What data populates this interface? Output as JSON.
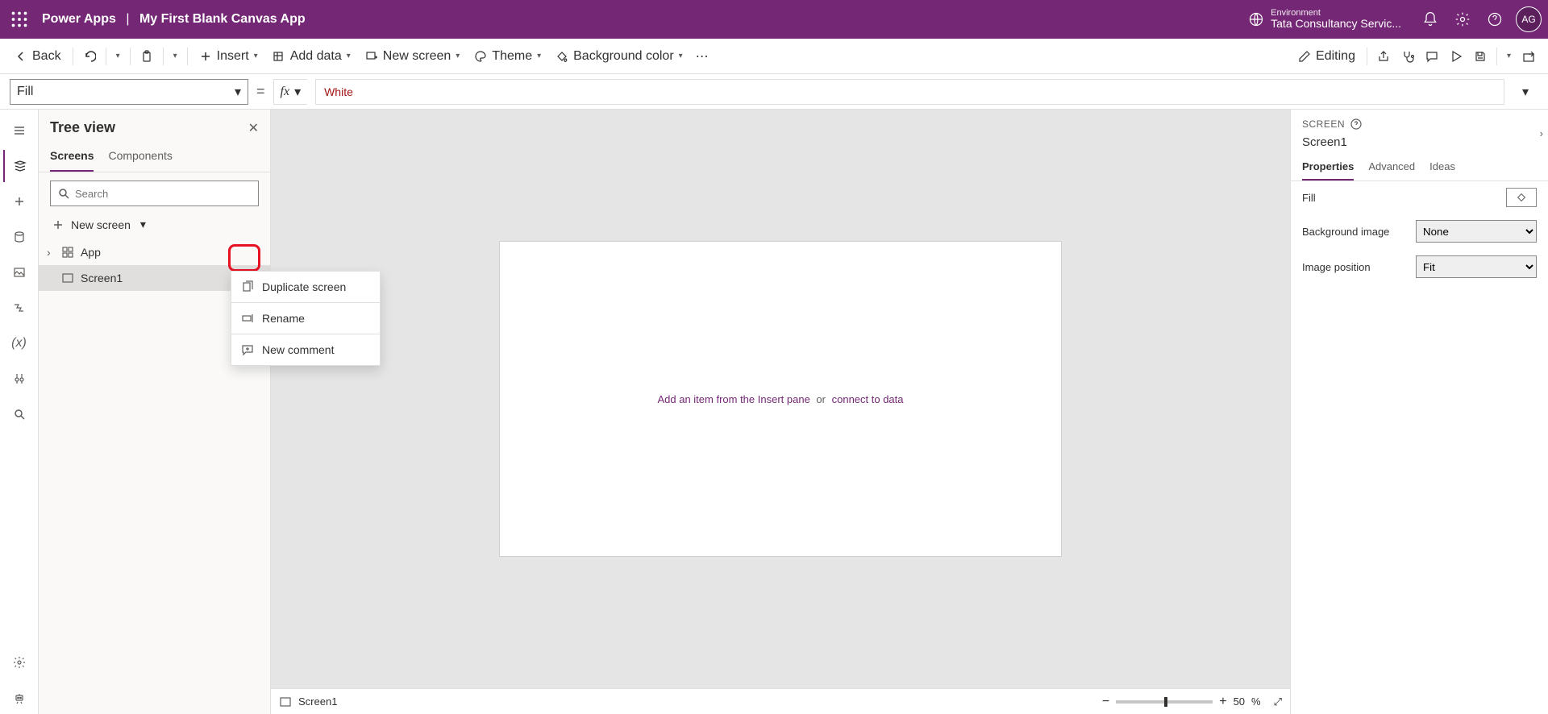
{
  "header": {
    "brand": "Power Apps",
    "separator": "|",
    "app_name": "My First Blank Canvas App",
    "env_label": "Environment",
    "env_value": "Tata Consultancy Servic...",
    "avatar": "AG"
  },
  "cmdbar": {
    "back": "Back",
    "insert": "Insert",
    "add_data": "Add data",
    "new_screen": "New screen",
    "theme": "Theme",
    "bg_color": "Background color",
    "editing": "Editing"
  },
  "formula": {
    "property": "Fill",
    "value": "White"
  },
  "tree": {
    "title": "Tree view",
    "tab_screens": "Screens",
    "tab_components": "Components",
    "search_placeholder": "Search",
    "new_screen": "New screen",
    "node_app": "App",
    "node_screen1": "Screen1"
  },
  "context_menu": {
    "duplicate": "Duplicate screen",
    "rename": "Rename",
    "new_comment": "New comment"
  },
  "canvas": {
    "hint_pre": "Add an item from the ",
    "hint_link1": "Insert pane",
    "hint_or": "or",
    "hint_link2": "connect to data"
  },
  "statusbar": {
    "selected": "Screen1",
    "zoom": "50",
    "zoom_unit": "%"
  },
  "right": {
    "kind": "SCREEN",
    "name": "Screen1",
    "tab_props": "Properties",
    "tab_adv": "Advanced",
    "tab_ideas": "Ideas",
    "row_fill": "Fill",
    "row_bgimg": "Background image",
    "row_bgimg_val": "None",
    "row_imgpos": "Image position",
    "row_imgpos_val": "Fit"
  }
}
